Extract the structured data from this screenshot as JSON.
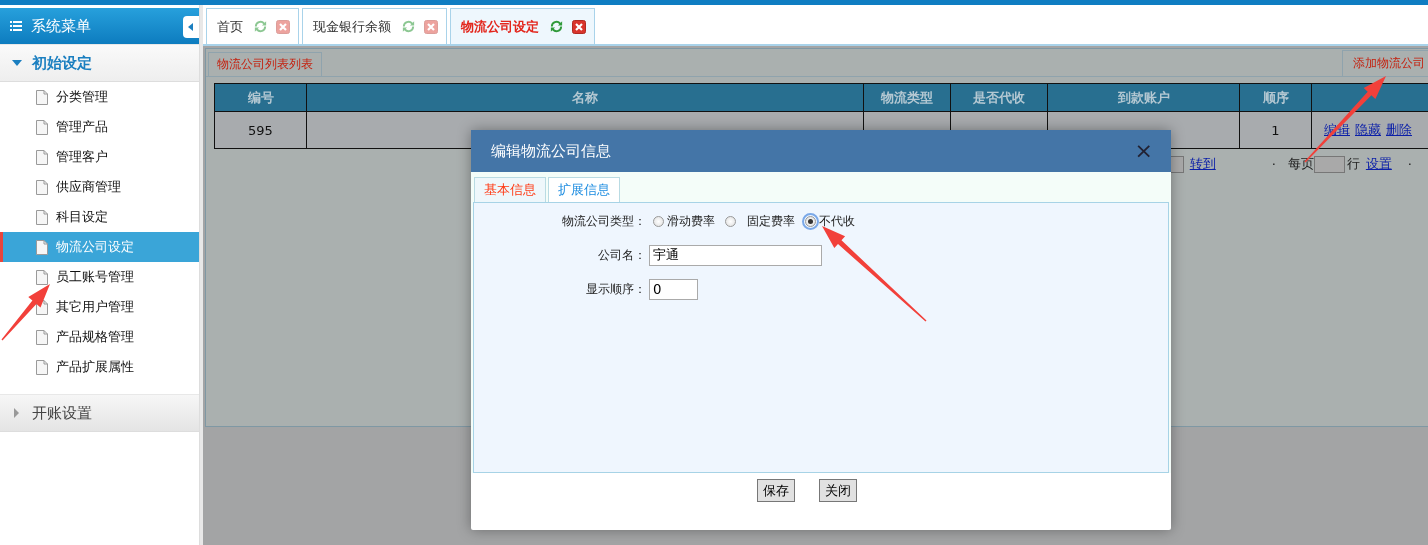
{
  "sidebar": {
    "title": "系统菜单",
    "groups": [
      {
        "label": "初始设定",
        "expanded": true,
        "items": [
          {
            "label": "分类管理",
            "selected": false
          },
          {
            "label": "管理产品",
            "selected": false
          },
          {
            "label": "管理客户",
            "selected": false
          },
          {
            "label": "供应商管理",
            "selected": false
          },
          {
            "label": "科目设定",
            "selected": false
          },
          {
            "label": "物流公司设定",
            "selected": true
          },
          {
            "label": "员工账号管理",
            "selected": false
          },
          {
            "label": "其它用户管理",
            "selected": false
          },
          {
            "label": "产品规格管理",
            "selected": false
          },
          {
            "label": "产品扩展属性",
            "selected": false
          }
        ]
      },
      {
        "label": "开账设置",
        "expanded": false
      }
    ]
  },
  "tabs": [
    {
      "label": "首页",
      "selected": false
    },
    {
      "label": "现金银行余额",
      "selected": false
    },
    {
      "label": "物流公司设定",
      "selected": true
    }
  ],
  "panel": {
    "tab": "物流公司列表列表",
    "add_button": "添加物流公司",
    "table": {
      "columns": [
        "编号",
        "名称",
        "物流类型",
        "是否代收",
        "到款账户",
        "顺序"
      ],
      "rows": [
        {
          "id": "595",
          "order": "1",
          "actions": [
            "编辑",
            "隐藏",
            "删除"
          ]
        }
      ]
    },
    "pager": {
      "goto": "转到",
      "dot_1": "·",
      "per_page": "每页",
      "rows_unit": "行",
      "apply": "设置",
      "dot_2": "·"
    }
  },
  "dialog": {
    "title": "编辑物流公司信息",
    "close": "×",
    "tabs": [
      {
        "label": "基本信息",
        "selected": true
      },
      {
        "label": "扩展信息",
        "selected": false
      }
    ],
    "fields": [
      {
        "kind": "radio",
        "label": "物流公司类型：",
        "options": [
          {
            "label": "滑动费率",
            "selected": false
          },
          {
            "label": "固定费率",
            "selected": false
          },
          {
            "label": "不代收",
            "selected": true
          }
        ]
      },
      {
        "kind": "text",
        "label": "公司名：",
        "value": "宇通"
      },
      {
        "kind": "text",
        "label": "显示顺序：",
        "value": "0"
      }
    ],
    "buttons": [
      "保存",
      "关闭"
    ]
  }
}
